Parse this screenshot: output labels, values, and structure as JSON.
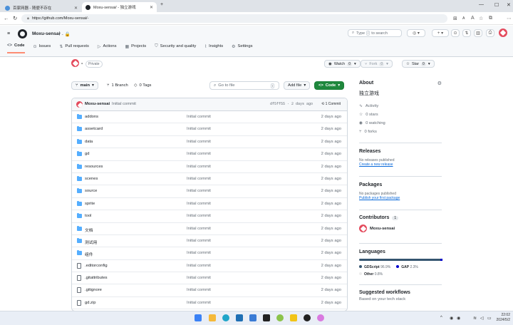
{
  "browser": {
    "tabs": [
      {
        "label": "百家网器 - 随便不存在"
      },
      {
        "label": "Moxu-sensai/ - 独立游戏"
      }
    ],
    "url": "https://github.com/Moxu-sensai/-"
  },
  "header": {
    "owner": "Moxu-sensai",
    "separator": "/ - 🔒",
    "search_prefix": "Type",
    "search_key": "/",
    "search_suffix": "to search"
  },
  "repo_nav": [
    {
      "icon": "<>",
      "label": "Code"
    },
    {
      "icon": "⊙",
      "label": "Issues"
    },
    {
      "icon": "⇅",
      "label": "Pull requests"
    },
    {
      "icon": "▷",
      "label": "Actions"
    },
    {
      "icon": "▦",
      "label": "Projects"
    },
    {
      "icon": "⛉",
      "label": "Security and quality"
    },
    {
      "icon": "⌇",
      "label": "Insights"
    },
    {
      "icon": "⚙",
      "label": "Settings"
    }
  ],
  "repo": {
    "name": "-",
    "visibility": "Private",
    "watch_label": "Watch",
    "watch_count": "0",
    "fork_label": "Fork",
    "fork_count": "0",
    "star_label": "Star",
    "star_count": "0"
  },
  "toolbar": {
    "branch": "main",
    "branches": "1 Branch",
    "tags": "0 Tags",
    "goto_placeholder": "Go to file",
    "goto_key": "t",
    "add_file": "Add file",
    "code": "Code"
  },
  "commit": {
    "author": "Moxu-sensai",
    "message": "Initial commit",
    "hash_time": "df5ff55 · 2 days ago",
    "count": "1 Commit"
  },
  "files": [
    {
      "name": "addons",
      "type": "dir",
      "message": "Initial commit",
      "date": "2 days ago"
    },
    {
      "name": "assetcard",
      "type": "dir",
      "message": "Initial commit",
      "date": "2 days ago"
    },
    {
      "name": "data",
      "type": "dir",
      "message": "Initial commit",
      "date": "2 days ago"
    },
    {
      "name": "gd",
      "type": "dir",
      "message": "Initial commit",
      "date": "2 days ago"
    },
    {
      "name": "resources",
      "type": "dir",
      "message": "Initial commit",
      "date": "2 days ago"
    },
    {
      "name": "scenes",
      "type": "dir",
      "message": "Initial commit",
      "date": "2 days ago"
    },
    {
      "name": "source",
      "type": "dir",
      "message": "Initial commit",
      "date": "2 days ago"
    },
    {
      "name": "sprite",
      "type": "dir",
      "message": "Initial commit",
      "date": "2 days ago"
    },
    {
      "name": "tool",
      "type": "dir",
      "message": "Initial commit",
      "date": "2 days ago"
    },
    {
      "name": "文档",
      "type": "dir",
      "message": "Initial commit",
      "date": "2 days ago"
    },
    {
      "name": "测试用",
      "type": "dir",
      "message": "Initial commit",
      "date": "2 days ago"
    },
    {
      "name": "组件",
      "type": "dir",
      "message": "Initial commit",
      "date": "2 days ago"
    },
    {
      "name": ".editorconfig",
      "type": "file",
      "message": "Initial commit",
      "date": "2 days ago"
    },
    {
      "name": ".gitattributes",
      "type": "file",
      "message": "Initial commit",
      "date": "2 days ago"
    },
    {
      "name": ".gitignore",
      "type": "file",
      "message": "Initial commit",
      "date": "2 days ago"
    },
    {
      "name": "gd.zip",
      "type": "file",
      "message": "Initial commit",
      "date": "2 days ago"
    }
  ],
  "about": {
    "title": "About",
    "description": "独立游戏",
    "activity": "Activity",
    "stars": "0 stars",
    "watching": "0 watching",
    "forks": "0 forks"
  },
  "releases": {
    "title": "Releases",
    "none": "No releases published",
    "link": "Create a new release"
  },
  "packages": {
    "title": "Packages",
    "none": "No packages published",
    "link": "Publish your first package"
  },
  "contributors": {
    "title": "Contributors",
    "count": "1",
    "name": "Moxu-sensai"
  },
  "languages": {
    "title": "Languages",
    "items": [
      {
        "name": "GDScript",
        "percent": "96.9%",
        "fraction": 0.969,
        "color": "#355570"
      },
      {
        "name": "GAP",
        "percent": "2.3%",
        "fraction": 0.023,
        "color": "#0000cc"
      },
      {
        "name": "Other",
        "percent": "0.8%",
        "fraction": 0.008,
        "color": "#ededed"
      }
    ]
  },
  "workflows": {
    "title": "Suggested workflows",
    "subtitle": "Based on your tech stack"
  },
  "clock": {
    "time": "22:02",
    "date": "2024/5/2"
  }
}
